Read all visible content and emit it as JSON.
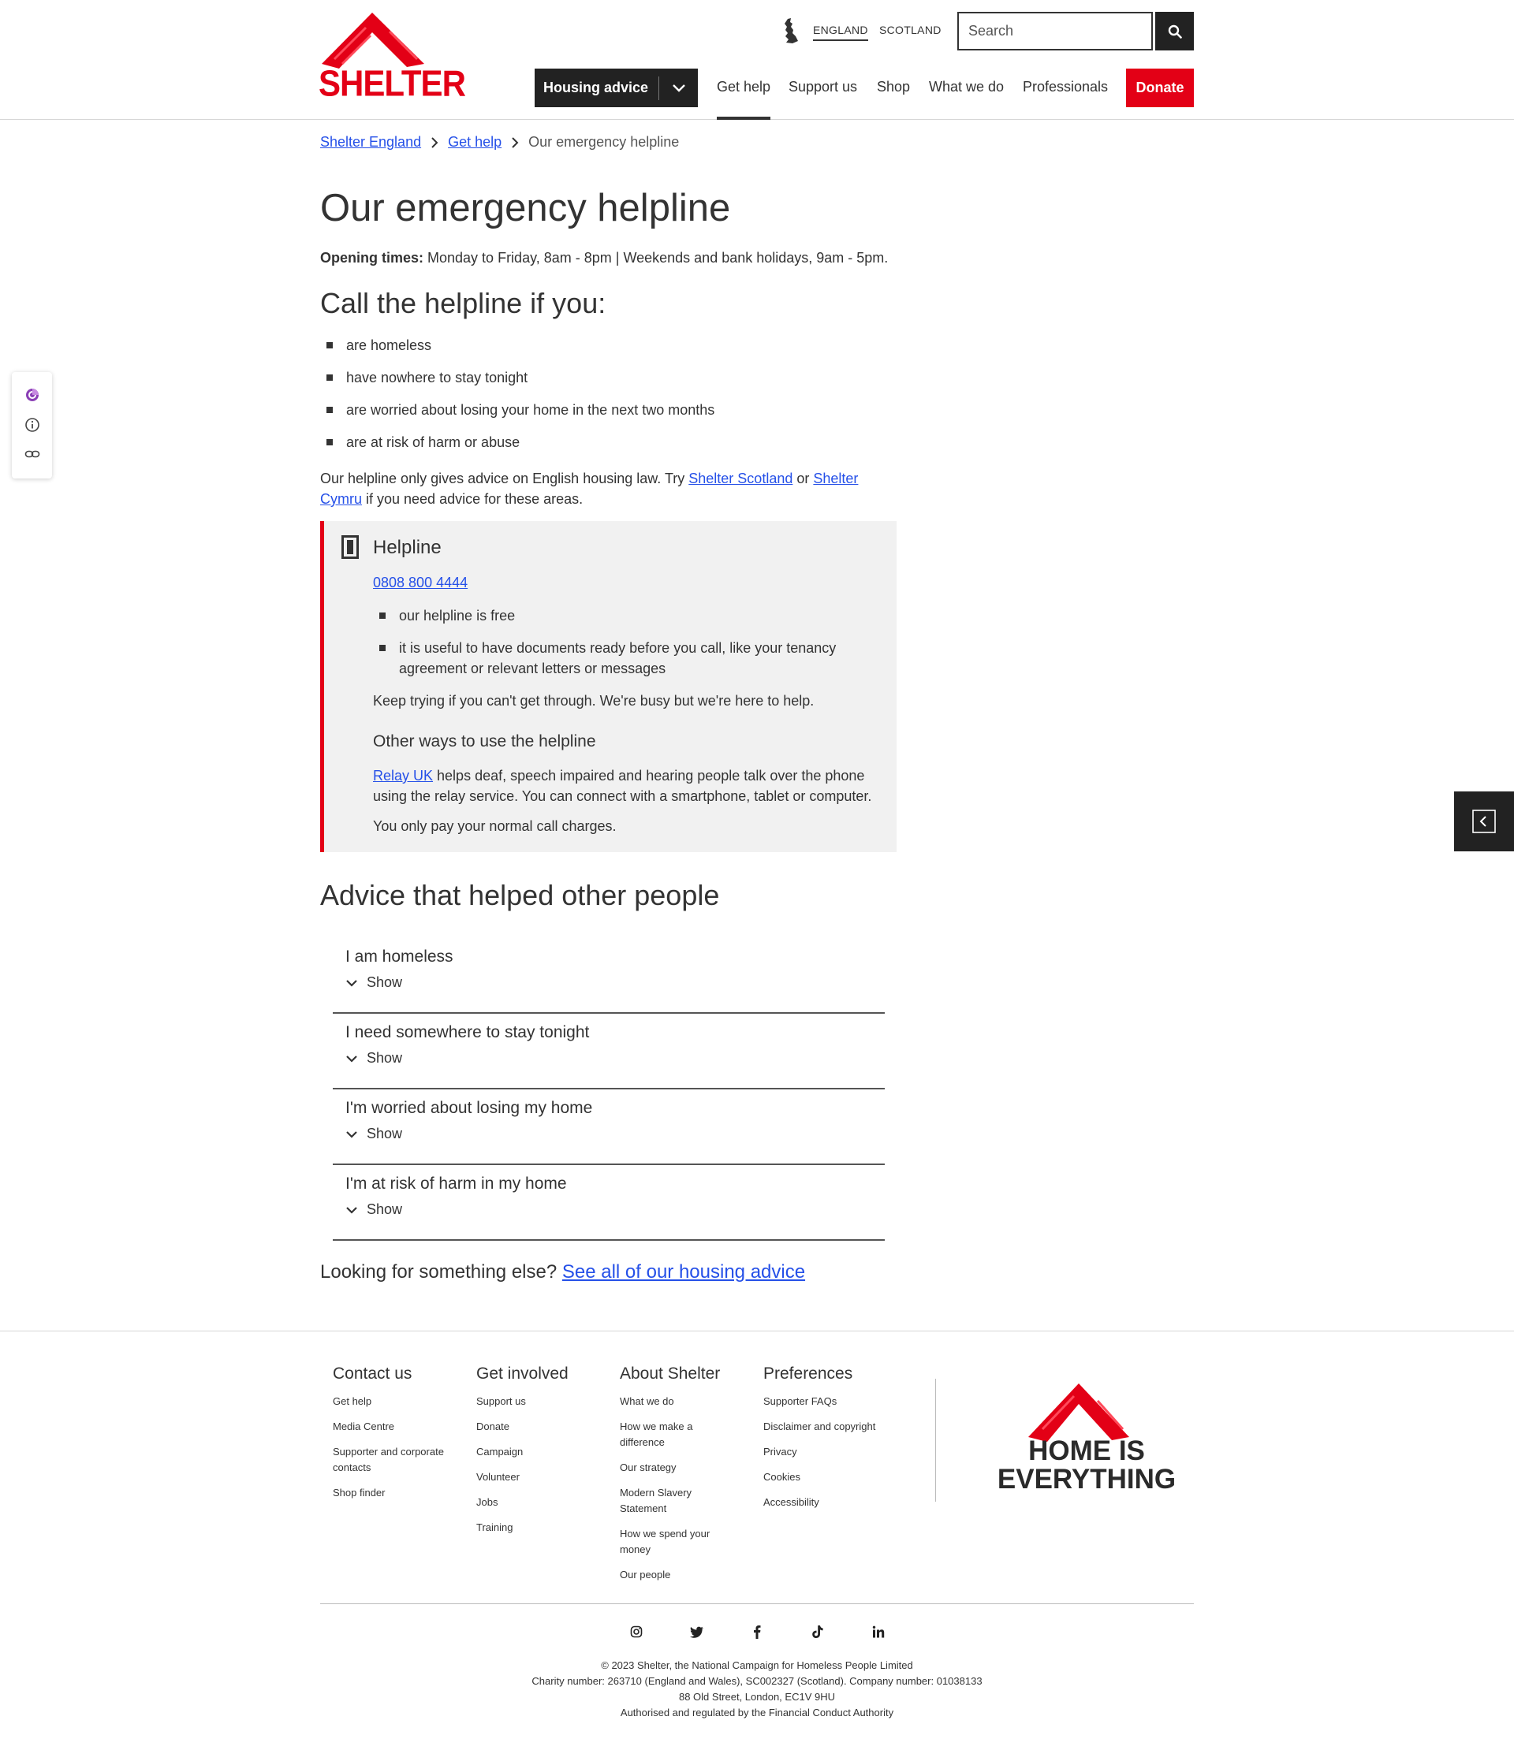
{
  "header": {
    "logo_text": "SHELTER",
    "regions": [
      "ENGLAND",
      "SCOTLAND"
    ],
    "search_placeholder": "Search",
    "housing_advice_label": "Housing advice",
    "nav": [
      "Get help",
      "Support us",
      "Shop",
      "What we do",
      "Professionals"
    ],
    "donate_label": "Donate",
    "brand_color": "#e30016"
  },
  "breadcrumb": {
    "items": [
      "Shelter England",
      "Get help"
    ],
    "current": "Our emergency helpline"
  },
  "main": {
    "title": "Our emergency helpline",
    "opening_label": "Opening times:",
    "opening_text": " Monday to Friday, 8am - 8pm | Weekends and bank holidays, 9am - 5pm.",
    "call_title": "Call the helpline if you:",
    "call_items": [
      "are homeless",
      "have nowhere to stay tonight",
      "are worried about losing your home in the next two months",
      "are at risk of harm or abuse"
    ],
    "law_pre": "Our helpline only gives advice on English housing law. Try ",
    "law_link1": "Shelter Scotland",
    "law_mid": " or ",
    "law_link2": "Shelter Cymru",
    "law_post": " if you need advice for these areas."
  },
  "helpline": {
    "title": "Helpline",
    "number": "0808 800 4444",
    "items": [
      "our helpline is free",
      "it is useful to have documents ready before you call, like your tenancy agreement or relevant letters or messages"
    ],
    "keep_trying": "Keep trying if you can't get through. We're busy but we're here to help.",
    "other_ways": "Other ways to use the helpline",
    "relay_link": "Relay UK",
    "relay_text": " helps deaf, speech impaired and hearing people talk over the phone using the relay service. You can connect with a smartphone, tablet or computer.",
    "call_charges": "You only pay your normal call charges."
  },
  "advice": {
    "title": "Advice that helped other people",
    "show_label": "Show",
    "items": [
      "I am homeless",
      "I need somewhere to stay tonight",
      "I'm worried about losing my home",
      "I'm at risk of harm in my home"
    ],
    "looking_text": "Looking for something else? ",
    "looking_link": "See all of our housing advice"
  },
  "footer": {
    "columns": [
      {
        "title": "Contact us",
        "links": [
          "Get help",
          "Media Centre",
          "Supporter and corporate contacts",
          "Shop finder"
        ]
      },
      {
        "title": "Get involved",
        "links": [
          "Support us",
          "Donate",
          "Campaign",
          "Volunteer",
          "Jobs",
          "Training"
        ]
      },
      {
        "title": "About Shelter",
        "links": [
          "What we do",
          "How we make a difference",
          "Our strategy",
          "Modern Slavery Statement",
          "How we spend your money",
          "Our people"
        ]
      },
      {
        "title": "Preferences",
        "links": [
          "Supporter FAQs",
          "Disclaimer and copyright",
          "Privacy",
          "Cookies",
          "Accessibility"
        ]
      }
    ],
    "tagline_line1": "HOME IS",
    "tagline_line2": "EVERYTHING",
    "social": [
      "instagram-icon",
      "twitter-icon",
      "facebook-icon",
      "tiktok-icon",
      "linkedin-icon"
    ],
    "legal": [
      "© 2023 Shelter, the National Campaign for Homeless People Limited",
      "Charity number: 263710 (England and Wales), SC002327 (Scotland). Company number: 01038133",
      "88 Old Street, London, EC1V 9HU",
      "Authorised and regulated by the Financial Conduct Authority"
    ]
  }
}
